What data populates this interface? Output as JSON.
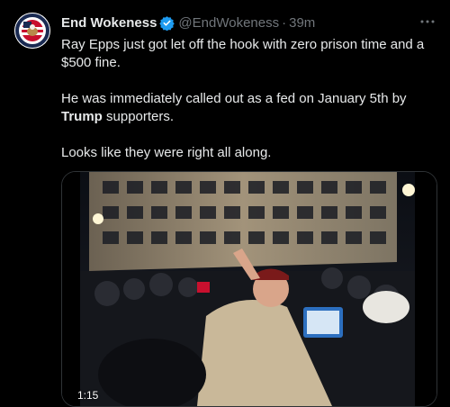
{
  "tweet": {
    "author_name": "End Wokeness",
    "author_handle": "@EndWokeness",
    "separator": "·",
    "time": "39m",
    "more_label": "···",
    "text": {
      "line1_a": "Ray Epps just got let off the hook with zero prison time and a",
      "line1_b": "$500 fine.",
      "line2_a": "He was immediately called out as a fed on January 5th by",
      "line2_bold": "Trump",
      "line2_c": " supporters.",
      "line3": "Looks like they were right all along."
    },
    "media": {
      "video_time": "1:15"
    },
    "avatar_ring_text": "END WOKENESS"
  },
  "colors": {
    "background": "#000000",
    "text": "#e7e9ea",
    "muted": "#71767b",
    "verified": "#1d9bf0"
  },
  "icons": {
    "verified": "verified-badge-icon",
    "more": "more-horizontal-icon"
  }
}
